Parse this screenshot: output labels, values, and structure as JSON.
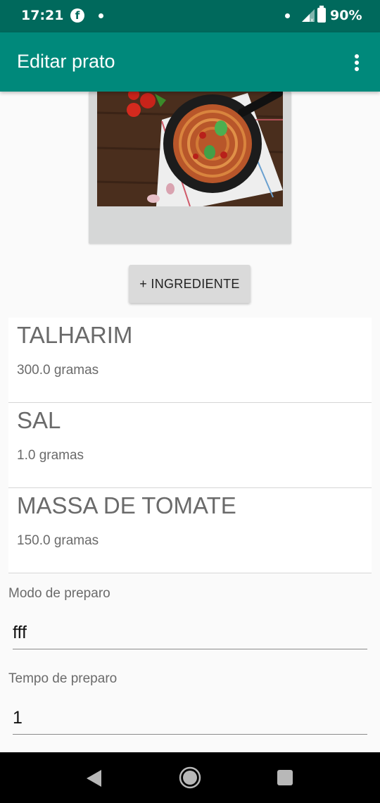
{
  "status_bar": {
    "time": "17:21",
    "battery": "90%",
    "icons": [
      "facebook-icon",
      "notification-dot-icon",
      "signal-icon",
      "battery-icon"
    ]
  },
  "app_bar": {
    "title": "Editar prato",
    "menu_icon": "overflow-menu-icon"
  },
  "dish_photo": {
    "subject": "spaghetti with tomato sauce in a pan"
  },
  "add_ingredient_button": "+ INGREDIENTE",
  "ingredients": [
    {
      "name": "TALHARIM",
      "quantity": "300.0 gramas"
    },
    {
      "name": "SAL",
      "quantity": "1.0 gramas"
    },
    {
      "name": "MASSA DE TOMATE",
      "quantity": "150.0 gramas"
    }
  ],
  "fields": {
    "modo_label": "Modo de preparo",
    "modo_value": "fff",
    "tempo_label": "Tempo de preparo",
    "tempo_value": "1"
  },
  "colors": {
    "status_bar": "#00695c",
    "app_bar": "#00897b",
    "background": "#fafafa"
  },
  "nav_bar": [
    "back-icon",
    "home-icon",
    "recents-icon"
  ]
}
